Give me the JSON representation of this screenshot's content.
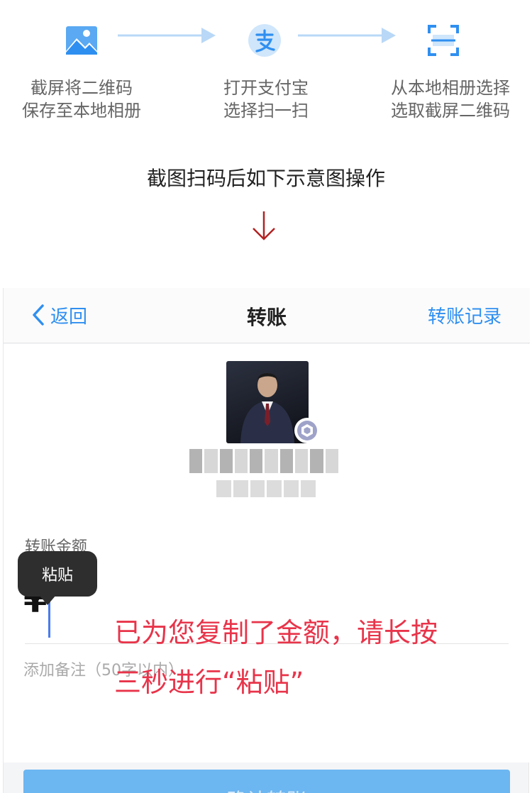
{
  "steps": [
    {
      "icon": "image-icon",
      "line1": "截屏将二维码",
      "line2": "保存至本地相册"
    },
    {
      "icon": "alipay-icon",
      "line1": "打开支付宝",
      "line2": "选择扫一扫"
    },
    {
      "icon": "scan-icon",
      "line1": "从本地相册选择",
      "line2": "选取截屏二维码"
    }
  ],
  "hint": "截图扫码后如下示意图操作",
  "colors": {
    "accent": "#2f8ff0",
    "notice": "#e8344a",
    "confirm": "#6cb6f1",
    "arrow_down": "#b22222"
  },
  "nav": {
    "back_label": "返回",
    "title": "转账",
    "record_label": "转账记录"
  },
  "transfer": {
    "amount_label": "转账金额",
    "currency_symbol": "¥",
    "remark_placeholder": "添加备注（50字以内）",
    "paste_label": "粘贴",
    "notice_line1": "已为您复制了金额，请长按",
    "notice_line2": "三秒进行“粘贴”",
    "confirm_label": "确认转账"
  }
}
